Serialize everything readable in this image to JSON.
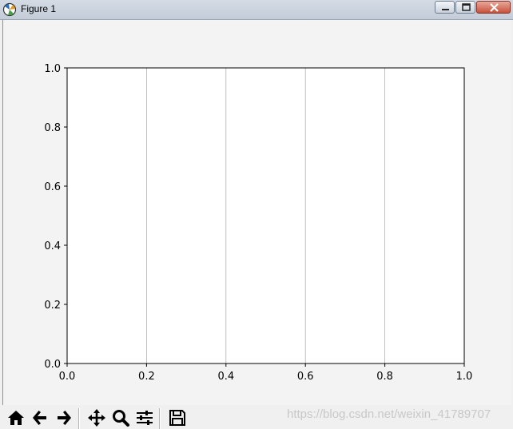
{
  "window": {
    "title": "Figure 1"
  },
  "chart_data": {
    "type": "line",
    "title": "",
    "xlabel": "",
    "ylabel": "",
    "xlim": [
      0.0,
      1.0
    ],
    "ylim": [
      0.0,
      1.0
    ],
    "x_ticks": [
      "0.0",
      "0.2",
      "0.4",
      "0.6",
      "0.8",
      "1.0"
    ],
    "y_ticks": [
      "0.0",
      "0.2",
      "0.4",
      "0.6",
      "0.8",
      "1.0"
    ],
    "grid": "vertical lines at x ticks",
    "series": []
  },
  "toolbar": {
    "tools": [
      "home-icon",
      "back-icon",
      "forward-icon",
      "pan-icon",
      "zoom-icon",
      "configure-subplots-icon",
      "save-icon"
    ]
  },
  "watermark": "https://blog.csdn.net/weixin_41789707"
}
